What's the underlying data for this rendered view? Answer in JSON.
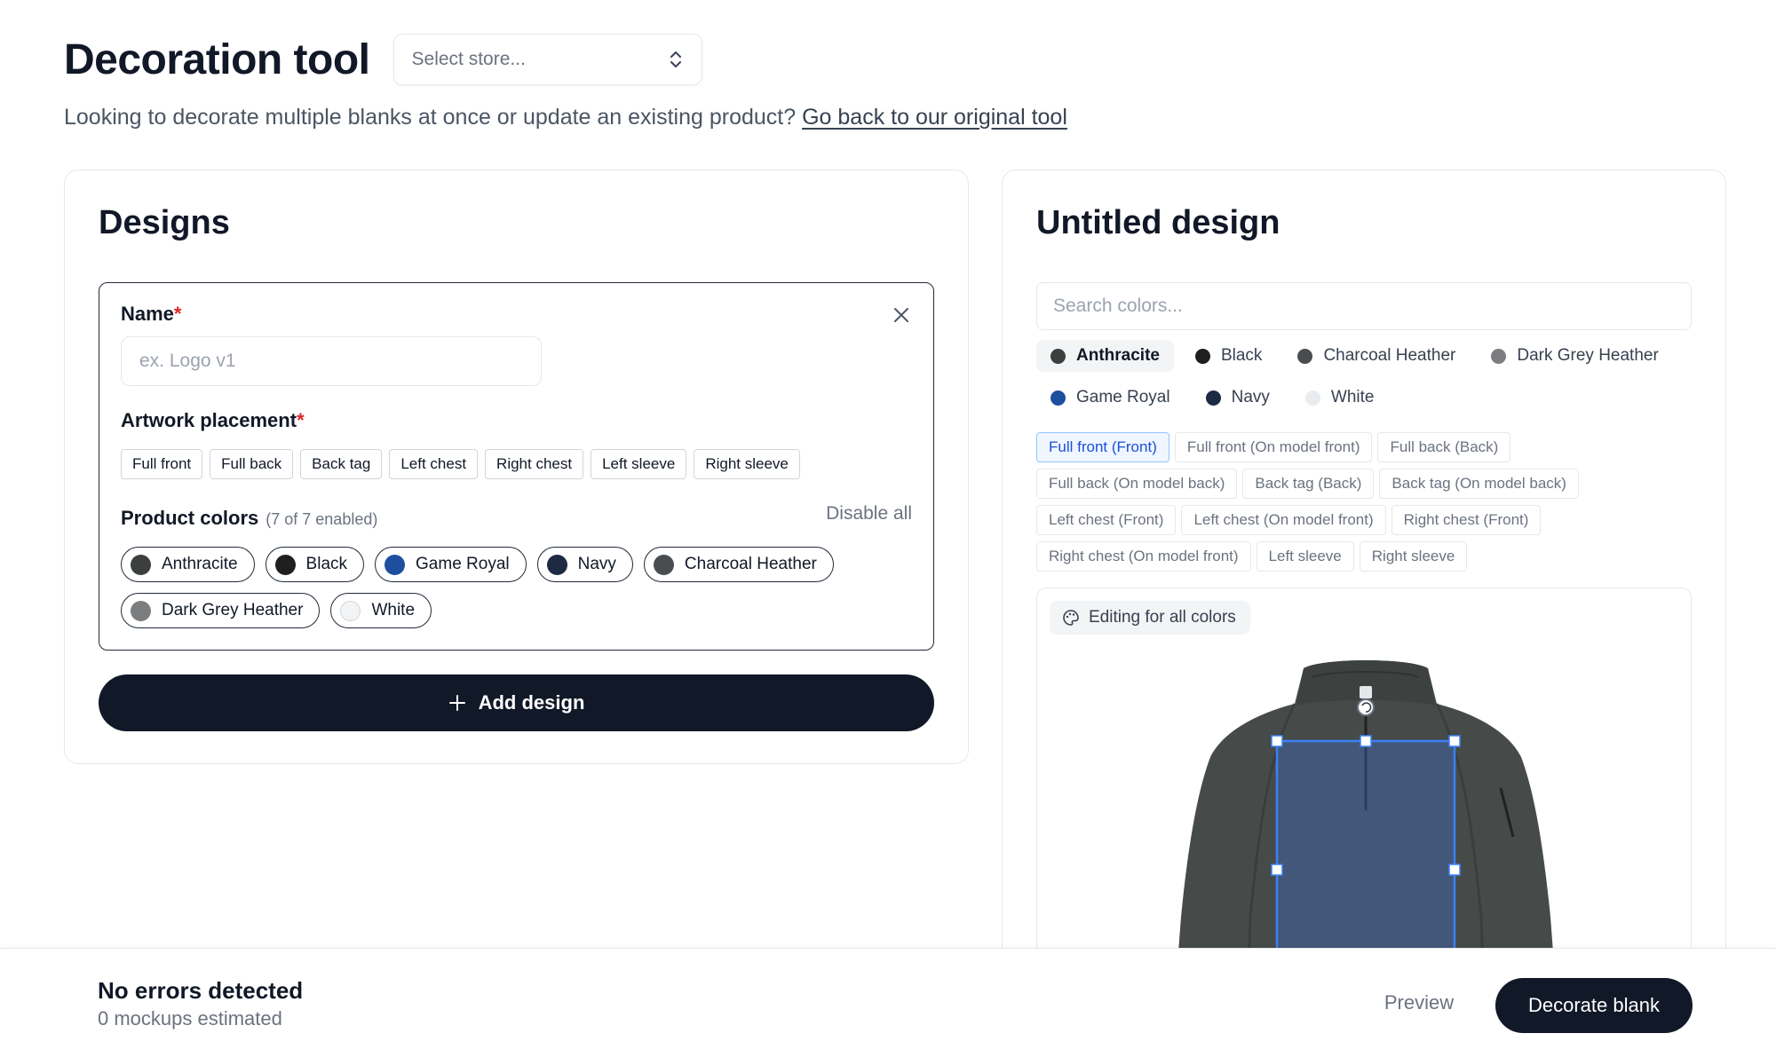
{
  "header": {
    "title": "Decoration tool",
    "store_placeholder": "Select store...",
    "subtitle_text": "Looking to decorate multiple blanks at once or update an existing product?",
    "subtitle_link": "Go back to our original tool"
  },
  "designs": {
    "title": "Designs",
    "name_label": "Name",
    "name_placeholder": "ex. Logo v1",
    "placement_label": "Artwork placement",
    "placements": [
      "Full front",
      "Full back",
      "Back tag",
      "Left chest",
      "Right chest",
      "Left sleeve",
      "Right sleeve"
    ],
    "colors_label": "Product colors",
    "colors_count": "(7 of 7 enabled)",
    "disable_all": "Disable all",
    "colors": [
      {
        "name": "Anthracite",
        "hex": "#3b3f3e"
      },
      {
        "name": "Black",
        "hex": "#1f1f1f"
      },
      {
        "name": "Game Royal",
        "hex": "#1d4f9e"
      },
      {
        "name": "Navy",
        "hex": "#1c2a44"
      },
      {
        "name": "Charcoal Heather",
        "hex": "#4a4d4f"
      },
      {
        "name": "Dark Grey Heather",
        "hex": "#7b7d7f"
      },
      {
        "name": "White",
        "hex": "#f1f3f5"
      }
    ],
    "add_button": "Add design"
  },
  "preview": {
    "title": "Untitled design",
    "search_placeholder": "Search colors...",
    "color_filters": [
      {
        "name": "Anthracite",
        "hex": "#3b3f3e",
        "active": true
      },
      {
        "name": "Black",
        "hex": "#1f1f1f",
        "active": false
      },
      {
        "name": "Charcoal Heather",
        "hex": "#4a4d4f",
        "active": false
      },
      {
        "name": "Dark Grey Heather",
        "hex": "#7b7d7f",
        "active": false
      },
      {
        "name": "Game Royal",
        "hex": "#1d4f9e",
        "active": false
      },
      {
        "name": "Navy",
        "hex": "#1c2a44",
        "active": false
      },
      {
        "name": "White",
        "hex": "#e9ecef",
        "active": false
      }
    ],
    "placements": [
      "Full front (Front)",
      "Full front (On model front)",
      "Full back (Back)",
      "Full back (On model back)",
      "Back tag (Back)",
      "Back tag (On model back)",
      "Left chest (Front)",
      "Left chest (On model front)",
      "Right chest (Front)",
      "Right chest (On model front)",
      "Left sleeve",
      "Right sleeve"
    ],
    "active_placement": "Full front (Front)",
    "editing_badge": "Editing for all colors"
  },
  "footer": {
    "status_title": "No errors detected",
    "status_sub": "0 mockups estimated",
    "preview_button": "Preview",
    "decorate_button": "Decorate blank"
  },
  "colors": {
    "primary": "#111827",
    "accent_blue": "#3b82f6",
    "required": "#dc2626"
  }
}
